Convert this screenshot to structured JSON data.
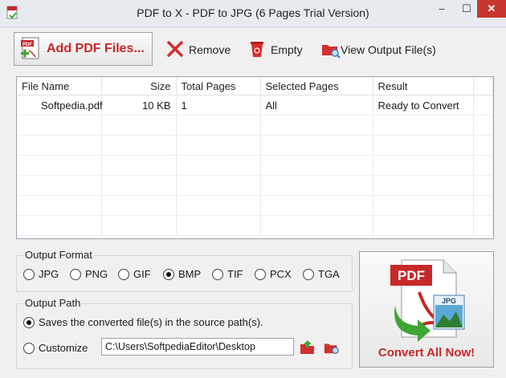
{
  "window": {
    "title": "PDF to X - PDF to JPG (6 Pages Trial Version)",
    "min_symbol": "–",
    "max_symbol": "☐",
    "close_symbol": "✕"
  },
  "toolbar": {
    "add_label": "Add PDF Files...",
    "remove_label": "Remove",
    "empty_label": "Empty",
    "view_label": "View Output File(s)"
  },
  "table": {
    "columns": [
      "File Name",
      "Size",
      "Total Pages",
      "Selected Pages",
      "Result"
    ],
    "rows": [
      [
        "Softpedia.pdf",
        "10 KB",
        "1",
        "All",
        "Ready to Convert"
      ],
      [
        "",
        "",
        "",
        "",
        ""
      ],
      [
        "",
        "",
        "",
        "",
        ""
      ],
      [
        "",
        "",
        "",
        "",
        ""
      ],
      [
        "",
        "",
        "",
        "",
        ""
      ],
      [
        "",
        "",
        "",
        "",
        ""
      ],
      [
        "",
        "",
        "",
        "",
        ""
      ]
    ]
  },
  "output_format": {
    "label": "Output Format",
    "options": [
      "JPG",
      "PNG",
      "GIF",
      "BMP",
      "TIF",
      "PCX",
      "TGA"
    ],
    "selected": "BMP"
  },
  "output_path": {
    "label": "Output Path",
    "source_option": "Saves the converted file(s) in the source path(s).",
    "custom_option": "Customize",
    "custom_value": "C:\\Users\\SoftpediaEditor\\Desktop",
    "selected": "source"
  },
  "convert": {
    "label": "Convert All Now!",
    "badge_pdf": "PDF",
    "badge_jpg": "JPG"
  },
  "colors": {
    "accent_red": "#c62828",
    "arrow_green": "#3fa535"
  }
}
